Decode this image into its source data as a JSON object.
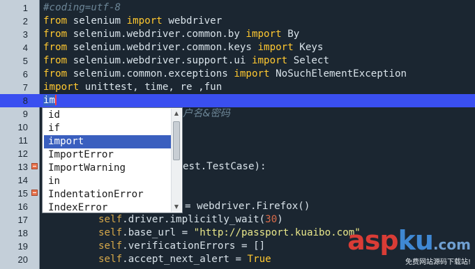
{
  "editor": {
    "lines": [
      {
        "n": "1"
      },
      {
        "n": "2"
      },
      {
        "n": "3"
      },
      {
        "n": "4"
      },
      {
        "n": "5"
      },
      {
        "n": "6"
      },
      {
        "n": "7"
      },
      {
        "n": "8"
      },
      {
        "n": "9"
      },
      {
        "n": "10"
      },
      {
        "n": "11"
      },
      {
        "n": "12"
      },
      {
        "n": "13"
      },
      {
        "n": "14"
      },
      {
        "n": "15"
      },
      {
        "n": "16"
      },
      {
        "n": "17"
      },
      {
        "n": "18"
      },
      {
        "n": "19"
      },
      {
        "n": "20"
      }
    ],
    "code": {
      "l1": "#coding=utf-8",
      "l2": {
        "kw1": "from",
        "t1": " selenium ",
        "kw2": "import",
        "t2": " webdriver"
      },
      "l3": {
        "kw1": "from",
        "t1": " selenium.webdriver.common.by ",
        "kw2": "import",
        "t2": " By"
      },
      "l4": {
        "kw1": "from",
        "t1": " selenium.webdriver.common.keys ",
        "kw2": "import",
        "t2": " Keys"
      },
      "l5": {
        "kw1": "from",
        "t1": " selenium.webdriver.support.ui ",
        "kw2": "import",
        "t2": " Select"
      },
      "l6": {
        "kw1": "from",
        "t1": " selenium.common.exceptions ",
        "kw2": "import",
        "t2": " NoSuchElementException"
      },
      "l7": {
        "kw1": "import",
        "t1": " unittest, time, re ,fun"
      },
      "l8": "im",
      "l9": "户名&密码",
      "l13": "est.TestCase):",
      "l16": "= webdriver.Firefox()",
      "l17": {
        "self": "self",
        "t1": ".driver.implicitly_wait(",
        "num": "30",
        "t2": ")"
      },
      "l18": {
        "self": "self",
        "t1": ".base_url = ",
        "str": "\"http://passport.kuaibo.com\""
      },
      "l19": {
        "self": "self",
        "t1": ".verificationErrors = []"
      },
      "l20": {
        "self": "self",
        "t1": ".accept_next_alert = ",
        "kw": "True"
      }
    }
  },
  "autocomplete": {
    "items": [
      "id",
      "if",
      "import",
      "ImportError",
      "ImportWarning",
      "in",
      "IndentationError",
      "IndexError"
    ],
    "selected": "import"
  },
  "watermark": {
    "logo_a": "asp",
    "logo_b": "ku",
    "logo_c": ".com",
    "subtitle": "免费网站源码下载站!"
  },
  "colors": {
    "background": "#1b2631",
    "keyword": "#ffc830",
    "current_line": "#3a4ff0",
    "selection": "#3a5fbf"
  }
}
